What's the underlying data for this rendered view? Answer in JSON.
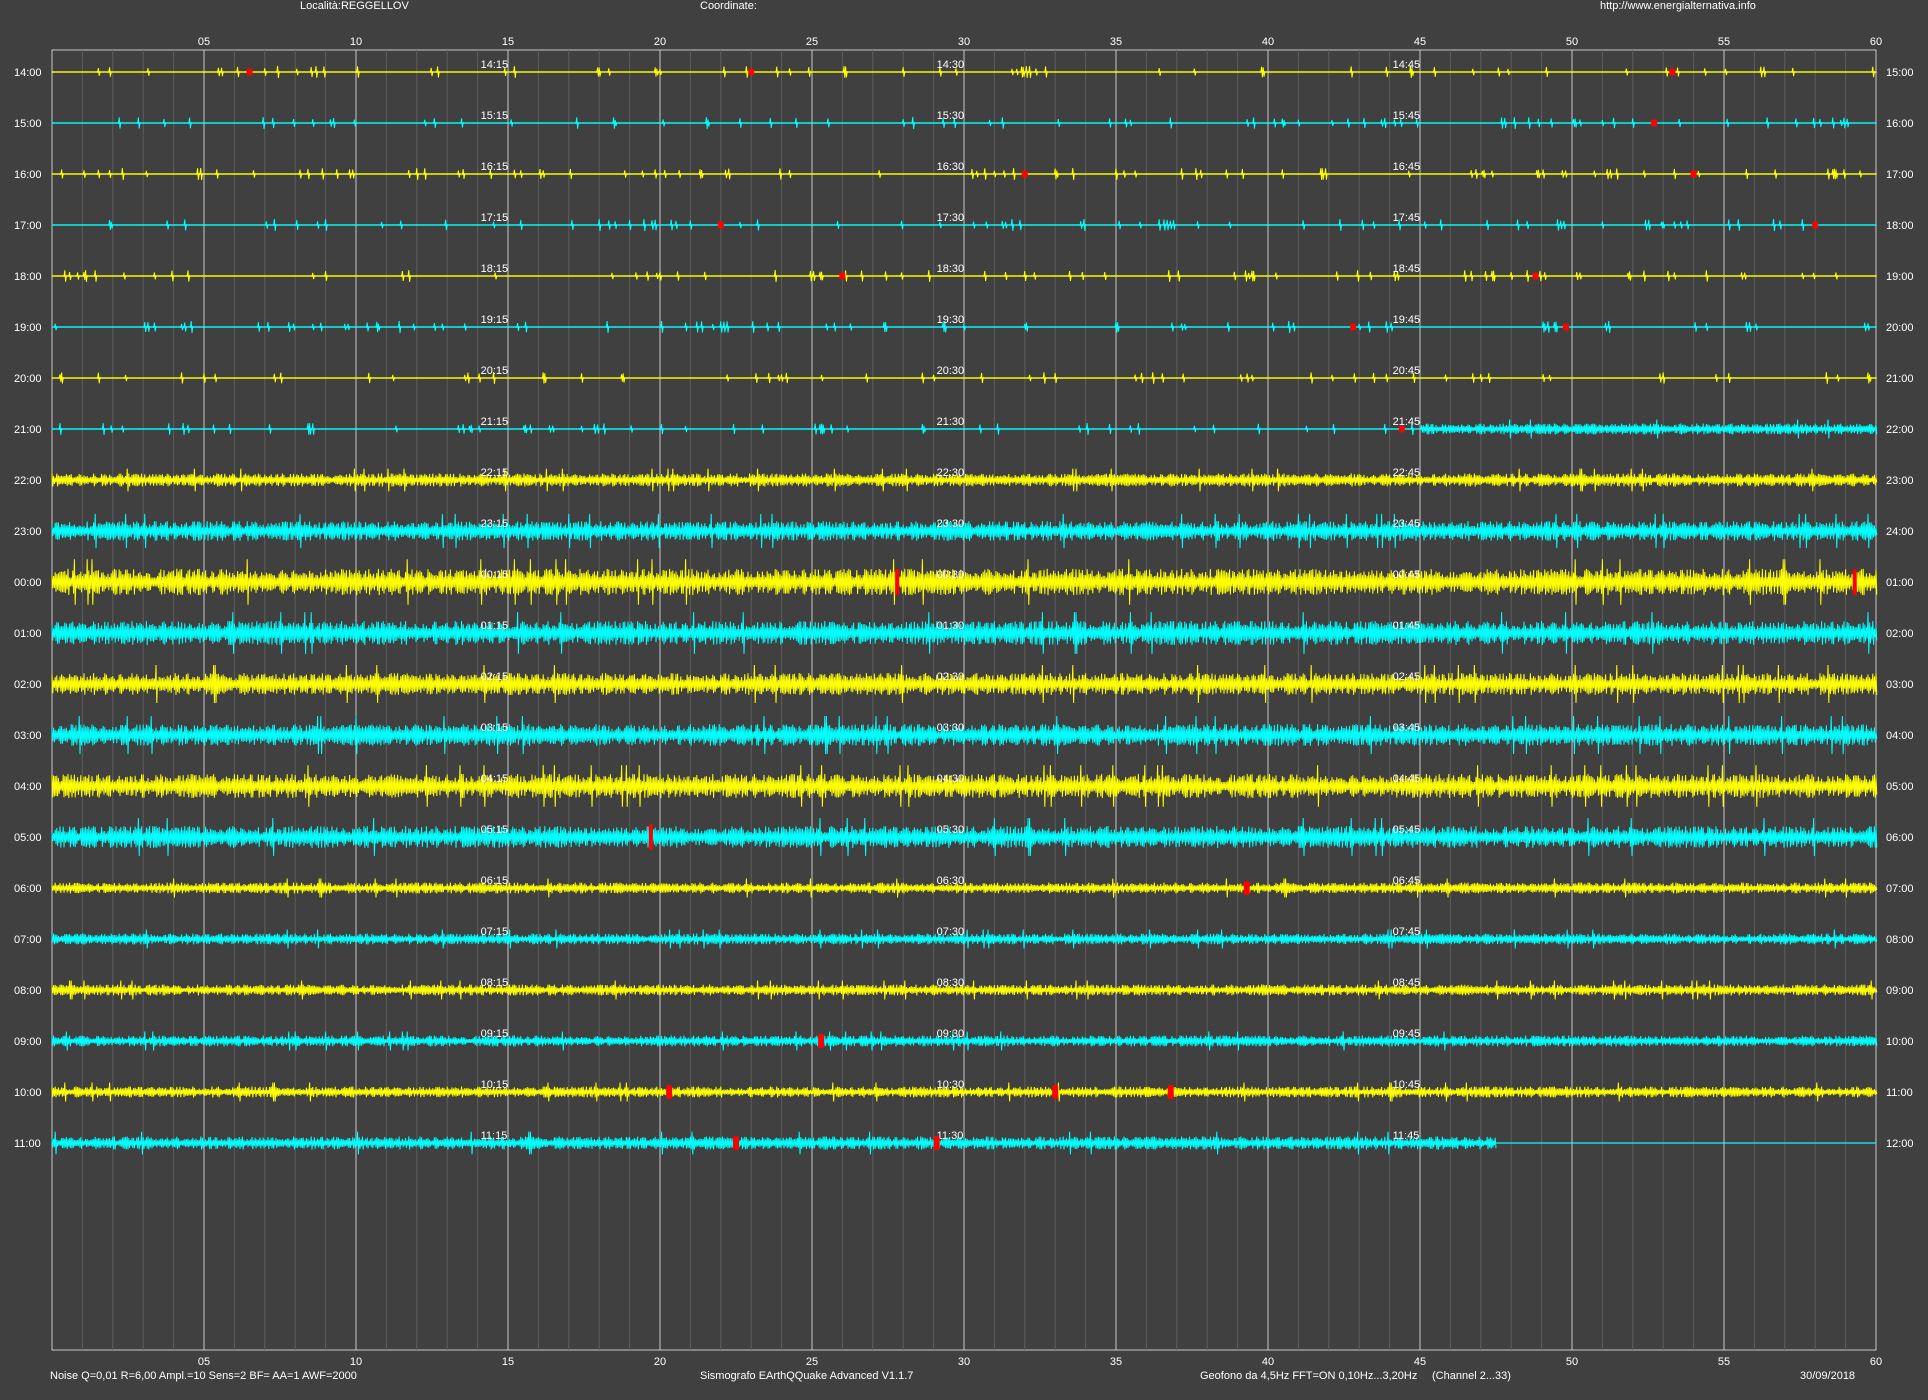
{
  "header": {
    "location": "Località:REGGELLOV",
    "coordinates": "Coordinate:",
    "url": "http://www.energialternativa.info"
  },
  "footer": {
    "params": "Noise Q=0,01 R=6,00 Ampl.=10 Sens=2 BF= AA=1 AWF=2000",
    "software": "Sismografo  EArthQQuake Advanced V1.1.7",
    "geofono": "Geofono da 4,5Hz FFT=ON 0,10Hz...3,20Hz",
    "channel": "(Channel 2...33)",
    "date": "30/09/2018"
  },
  "colors": {
    "background": "#404040",
    "grid": "#c8c8c8",
    "trace_a": "#ffff00",
    "trace_b": "#00ffff",
    "event": "#ff0000",
    "text": "#ffffff"
  },
  "chart_data": {
    "type": "line",
    "title": "",
    "xlabel": "",
    "ylabel": "",
    "x_unit": "minutes",
    "xlim": [
      0,
      60
    ],
    "x_ticks": [
      "05",
      "10",
      "15",
      "20",
      "25",
      "30",
      "35",
      "40",
      "45",
      "50",
      "55",
      "60"
    ],
    "x_tick_values": [
      5,
      10,
      15,
      20,
      25,
      30,
      35,
      40,
      45,
      50,
      55,
      60
    ],
    "grid": true,
    "rows": [
      {
        "start": "14:00",
        "end": "15:00",
        "q15": "14:15",
        "q30": "14:30",
        "q45": "14:45",
        "amplitude": 1,
        "end_minute": 60,
        "events": [
          6.5,
          23,
          53.3
        ]
      },
      {
        "start": "15:00",
        "end": "16:00",
        "q15": "15:15",
        "q30": "15:30",
        "q45": "15:45",
        "amplitude": 1,
        "end_minute": 60,
        "events": [
          52.7
        ]
      },
      {
        "start": "16:00",
        "end": "17:00",
        "q15": "16:15",
        "q30": "16:30",
        "q45": "16:45",
        "amplitude": 1,
        "end_minute": 60,
        "events": [
          32,
          54
        ]
      },
      {
        "start": "17:00",
        "end": "18:00",
        "q15": "17:15",
        "q30": "17:30",
        "q45": "17:45",
        "amplitude": 1,
        "end_minute": 60,
        "events": [
          22,
          58
        ]
      },
      {
        "start": "18:00",
        "end": "19:00",
        "q15": "18:15",
        "q30": "18:30",
        "q45": "18:45",
        "amplitude": 1,
        "end_minute": 60,
        "events": [
          26,
          48.8
        ]
      },
      {
        "start": "19:00",
        "end": "20:00",
        "q15": "19:15",
        "q30": "19:30",
        "q45": "19:45",
        "amplitude": 1,
        "end_minute": 60,
        "events": [
          42.8,
          49.8
        ]
      },
      {
        "start": "20:00",
        "end": "21:00",
        "q15": "20:15",
        "q30": "20:30",
        "q45": "20:45",
        "amplitude": 1,
        "end_minute": 60,
        "events": []
      },
      {
        "start": "21:00",
        "end": "22:00",
        "q15": "21:15",
        "q30": "21:30",
        "q45": "21:45",
        "amplitude": 1,
        "end_minute": 60,
        "events": [
          44.4
        ],
        "amplitude_change_at": 45,
        "amplitude_after": 5
      },
      {
        "start": "22:00",
        "end": "23:00",
        "q15": "22:15",
        "q30": "22:30",
        "q45": "22:45",
        "amplitude": 6,
        "end_minute": 60,
        "events": []
      },
      {
        "start": "23:00",
        "end": "24:00",
        "q15": "23:15",
        "q30": "23:30",
        "q45": "23:45",
        "amplitude": 9,
        "end_minute": 60,
        "events": []
      },
      {
        "start": "00:00",
        "end": "01:00",
        "q15": "00:15",
        "q30": "00:30",
        "q45": "00:45",
        "amplitude": 12,
        "end_minute": 60,
        "events": [
          27.8,
          59.3
        ]
      },
      {
        "start": "01:00",
        "end": "02:00",
        "q15": "01:15",
        "q30": "01:30",
        "q45": "01:45",
        "amplitude": 11,
        "end_minute": 60,
        "events": []
      },
      {
        "start": "02:00",
        "end": "03:00",
        "q15": "02:15",
        "q30": "02:30",
        "q45": "02:45",
        "amplitude": 10,
        "end_minute": 60,
        "events": []
      },
      {
        "start": "03:00",
        "end": "04:00",
        "q15": "03:15",
        "q30": "03:30",
        "q45": "03:45",
        "amplitude": 10,
        "end_minute": 60,
        "events": []
      },
      {
        "start": "04:00",
        "end": "05:00",
        "q15": "04:15",
        "q30": "04:30",
        "q45": "04:45",
        "amplitude": 11,
        "end_minute": 60,
        "events": []
      },
      {
        "start": "05:00",
        "end": "06:00",
        "q15": "05:15",
        "q30": "05:30",
        "q45": "05:45",
        "amplitude": 10,
        "end_minute": 60,
        "events": [
          19.7
        ]
      },
      {
        "start": "06:00",
        "end": "07:00",
        "q15": "06:15",
        "q30": "06:30",
        "q45": "06:45",
        "amplitude": 5,
        "end_minute": 60,
        "events": [
          39.3
        ]
      },
      {
        "start": "07:00",
        "end": "08:00",
        "q15": "07:15",
        "q30": "07:30",
        "q45": "07:45",
        "amplitude": 5,
        "end_minute": 60,
        "events": []
      },
      {
        "start": "08:00",
        "end": "09:00",
        "q15": "08:15",
        "q30": "08:30",
        "q45": "08:45",
        "amplitude": 5,
        "end_minute": 60,
        "events": []
      },
      {
        "start": "09:00",
        "end": "10:00",
        "q15": "09:15",
        "q30": "09:30",
        "q45": "09:45",
        "amplitude": 5,
        "end_minute": 60,
        "events": [
          25.3
        ]
      },
      {
        "start": "10:00",
        "end": "11:00",
        "q15": "10:15",
        "q30": "10:30",
        "q45": "10:45",
        "amplitude": 5,
        "end_minute": 60,
        "events": [
          20.3,
          33,
          36.8
        ]
      },
      {
        "start": "11:00",
        "end": "12:00",
        "q15": "11:15",
        "q30": "11:30",
        "q45": "11:45",
        "amplitude": 6,
        "end_minute": 47.5,
        "events": [
          22.5,
          29.1
        ]
      }
    ]
  }
}
